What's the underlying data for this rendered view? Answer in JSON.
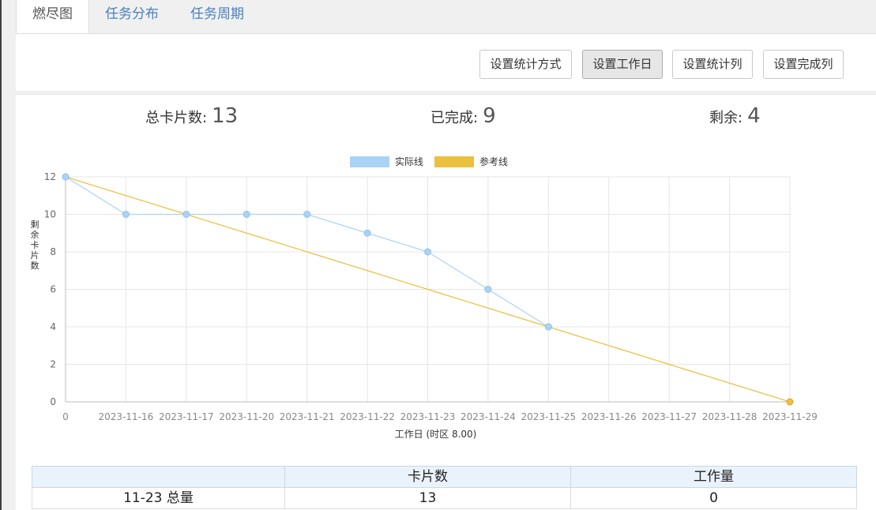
{
  "tabs": [
    {
      "label": "燃尽图",
      "active": true
    },
    {
      "label": "任务分布",
      "active": false
    },
    {
      "label": "任务周期",
      "active": false
    }
  ],
  "toolbar": {
    "buttons": [
      {
        "label": "设置统计方式"
      },
      {
        "label": "设置工作日",
        "active": true
      },
      {
        "label": "设置统计列"
      },
      {
        "label": "设置完成列"
      }
    ]
  },
  "stats": {
    "total_label": "总卡片数:",
    "total_value": "13",
    "done_label": "已完成:",
    "done_value": "9",
    "remaining_label": "剩余:",
    "remaining_value": "4"
  },
  "chart_data": {
    "type": "line",
    "categories": [
      "0",
      "2023-11-16",
      "2023-11-17",
      "2023-11-20",
      "2023-11-21",
      "2023-11-22",
      "2023-11-23",
      "2023-11-24",
      "2023-11-25",
      "2023-11-26",
      "2023-11-27",
      "2023-11-28",
      "2023-11-29"
    ],
    "series": [
      {
        "name": "实际线",
        "color": "#a9d4f5",
        "values": [
          12,
          10,
          10,
          10,
          10,
          9,
          8,
          6,
          4,
          null,
          null,
          null,
          null
        ]
      },
      {
        "name": "参考线",
        "color": "#ebc03f",
        "values": [
          12,
          11,
          10,
          9,
          8,
          7,
          6,
          5,
          4,
          3,
          2,
          1,
          0
        ]
      }
    ],
    "xlabel": "工作日 (时区 8.00)",
    "ylabel": "剩余卡片数",
    "ylim": [
      0,
      12
    ],
    "yticks": [
      0,
      2,
      4,
      6,
      8,
      10,
      12
    ],
    "grid": true,
    "legend": "top-center"
  },
  "table": {
    "headers": [
      "",
      "卡片数",
      "工作量"
    ],
    "rows": [
      [
        "11-23 总量",
        "13",
        "0"
      ]
    ]
  }
}
